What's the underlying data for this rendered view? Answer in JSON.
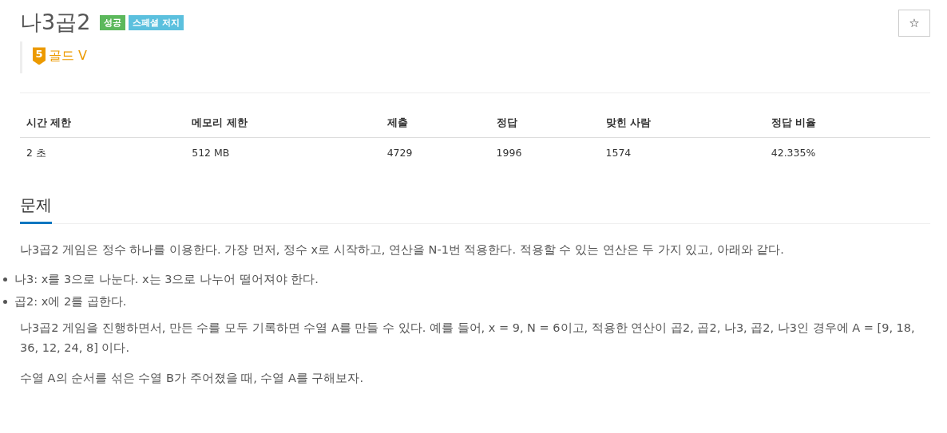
{
  "problem": {
    "title": "나3곱2",
    "labels": [
      {
        "text": "성공",
        "kind": "success"
      },
      {
        "text": "스페셜 저지",
        "kind": "info"
      }
    ],
    "tier": {
      "number": "5",
      "name": "골드 V"
    },
    "star_button": {
      "glyph": "☆"
    }
  },
  "stats_table": {
    "columns": [
      "시간 제한",
      "메모리 제한",
      "제출",
      "정답",
      "맞힌 사람",
      "정답 비율"
    ],
    "rows": [
      [
        "2 초",
        "512 MB",
        "4729",
        "1996",
        "1574",
        "42.335%"
      ]
    ]
  },
  "section": {
    "heading": "문제",
    "blocks": [
      {
        "kind": "paragraph",
        "text": "나3곱2 게임은 정수 하나를 이용한다. 가장 먼저, 정수 x로 시작하고, 연산을 N-1번 적용한다. 적용할 수 있는 연산은 두 가지 있고, 아래와 같다."
      },
      {
        "kind": "list",
        "items": [
          "나3: x를 3으로 나눈다. x는 3으로 나누어 떨어져야 한다.",
          "곱2: x에 2를 곱한다."
        ]
      },
      {
        "kind": "paragraph",
        "text": "나3곱2 게임을 진행하면서, 만든 수를 모두 기록하면 수열 A를 만들 수 있다. 예를 들어, x = 9, N = 6이고, 적용한 연산이 곱2, 곱2, 나3, 곱2, 나3인 경우에 A = [9, 18, 36, 12, 24, 8] 이다."
      },
      {
        "kind": "paragraph",
        "text": "수열 A의 순서를 섞은 수열 B가 주어졌을 때, 수열 A를 구해보자."
      }
    ]
  }
}
